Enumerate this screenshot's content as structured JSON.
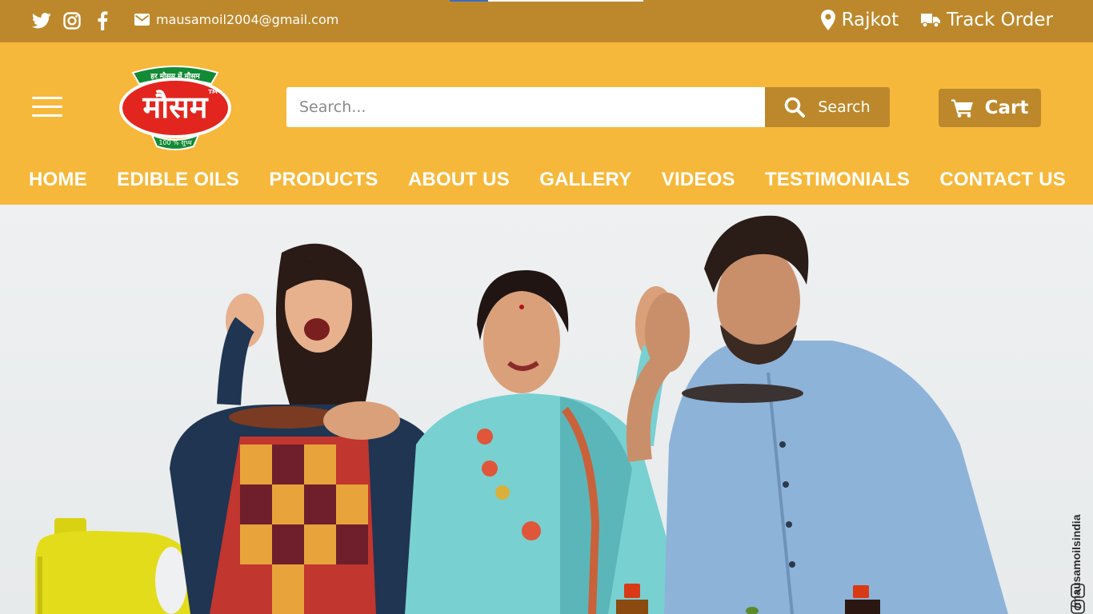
{
  "topbar": {
    "loading_progress": 0.2,
    "social": [
      {
        "name": "twitter-icon"
      },
      {
        "name": "instagram-icon"
      },
      {
        "name": "facebook-icon"
      }
    ],
    "email": "mausamoil2004@gmail.com",
    "location": "Rajkot",
    "track_order": "Track Order"
  },
  "header": {
    "logo": {
      "brand_text": "मौसम",
      "tagline": "हर मौसम में मौसम",
      "purity": "100 % शुध्ध",
      "trademark": "TM"
    },
    "search": {
      "placeholder": "Search...",
      "button_label": "Search"
    },
    "cart_label": "Cart"
  },
  "nav": {
    "items": [
      "HOME",
      "EDIBLE OILS",
      "PRODUCTS",
      "ABOUT US",
      "GALLERY",
      "VIDEOS",
      "TESTIMONIALS",
      "CONTACT US"
    ]
  },
  "hero": {
    "social_handle": "/mausamoilsindia"
  },
  "colors": {
    "topbar": "#bd882c",
    "header": "#f6b83b",
    "button": "#bd882c",
    "logo_red": "#e2261f",
    "logo_green": "#138a35"
  }
}
